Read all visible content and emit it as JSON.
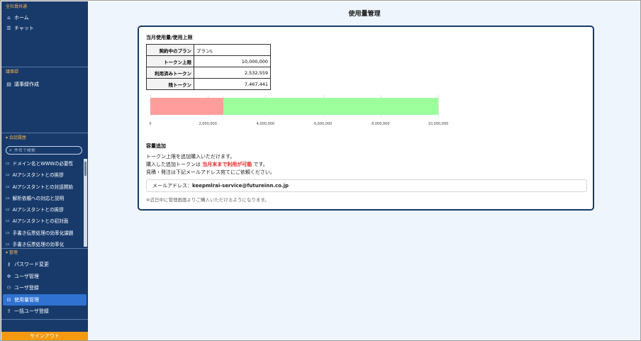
{
  "sidebar": {
    "common_title": "全社員共通",
    "common_items": [
      {
        "label": "ホーム",
        "icon": "home-icon"
      },
      {
        "label": "チャット",
        "icon": "chat-icon"
      }
    ],
    "minutes_title": "議事録",
    "minutes_items": [
      {
        "label": "議事録作成",
        "icon": "document-icon"
      }
    ],
    "history_title": "会話履歴",
    "search_placeholder": "件名で検索",
    "history_items": [
      "ドメイン名とWWWの必要性",
      "AIアシスタントとの挨拶",
      "AIアシスタントとの対話開始",
      "解析依頼への対応と説明",
      "AIアシスタントとの挨拶",
      "AIアシスタントとの初対面",
      "手書き伝票処理の効率化課題",
      "手書き伝票処理の効率化"
    ],
    "admin_title": "管理",
    "admin_items": [
      {
        "label": "パスワード変更",
        "icon": "key-icon"
      },
      {
        "label": "ユーザ管理",
        "icon": "users-icon"
      },
      {
        "label": "ユーザ登録",
        "icon": "user-add-icon"
      },
      {
        "label": "使用量管理",
        "icon": "usage-icon"
      },
      {
        "label": "一括ユーザ登録",
        "icon": "bulk-upload-icon"
      }
    ],
    "signout_label": "サインアウト"
  },
  "main": {
    "page_title": "使用量管理",
    "card_heading": "当月使用量/使用上限",
    "table": {
      "plan_label": "契約中のプラン",
      "plan_value": "プランL",
      "limit_label": "トークン上限",
      "limit_value": "10,000,000",
      "used_label": "利用済みトークン",
      "used_value": "2,532,559",
      "remaining_label": "残トークン",
      "remaining_value": "7,467,441"
    },
    "add_heading": "容量追加",
    "desc_line1": "トークン上限を追加購入いただけます。",
    "desc_line2_pre": "購入した追加トークンは",
    "desc_line2_highlight": "当月末まで利用が可能",
    "desc_line2_post": "です。",
    "desc_line3": "見積・発注は下記メールアドレス宛てにご依頼ください。",
    "mail_label": "メールアドレス：",
    "mail_address": "keepmlrai-service@futureinn.co.jp",
    "note": "※近日中に管理画面よりご購入いただけるようになります。"
  },
  "chart_data": {
    "type": "bar",
    "orientation": "horizontal-stacked",
    "series": [
      {
        "name": "",
        "values": [
          2532559
        ],
        "color": "#ff9c9c"
      },
      {
        "name": "",
        "values": [
          7467441
        ],
        "color": "#9cff9c"
      }
    ],
    "xlim": [
      0,
      10000000
    ],
    "xticks": [
      "0",
      "2,000,000",
      "4,000,000",
      "6,000,000",
      "8,000,000",
      "10,000,000"
    ],
    "grid": true
  },
  "colors": {
    "sidebar_bg": "#173a6b",
    "accent": "#2f72d1",
    "section_title": "#f6b24a",
    "signout": "#f49a10",
    "used": "#ff9c9c",
    "remaining": "#9cff9c",
    "highlight_red": "#e02020"
  }
}
